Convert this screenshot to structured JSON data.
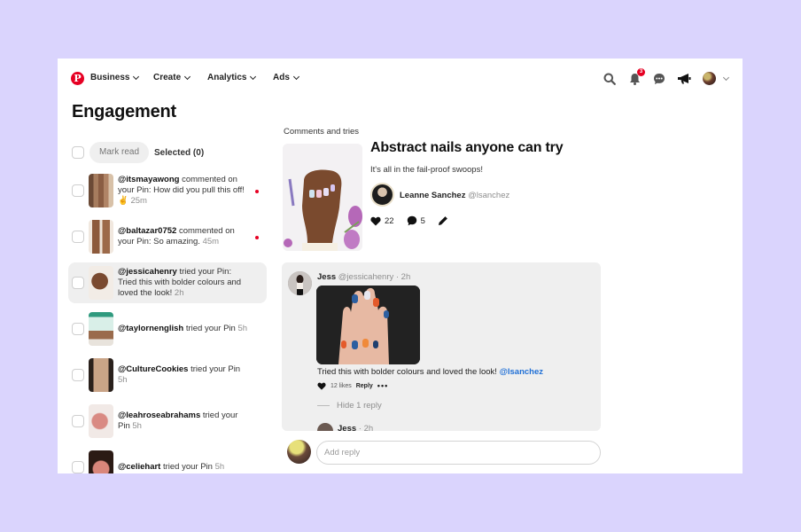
{
  "nav": {
    "logo": "P",
    "items": [
      {
        "label": "Business"
      },
      {
        "label": "Create"
      },
      {
        "label": "Analytics"
      },
      {
        "label": "Ads"
      }
    ],
    "notification_count": "3"
  },
  "page": {
    "title": "Engagement"
  },
  "toolbar": {
    "mark_read": "Mark read",
    "selected": "Selected (0)"
  },
  "notifications": [
    {
      "user": "@itsmayawong",
      "text": " commented on your Pin: How did you pull this off! ✌ ",
      "time": "25m",
      "unread": true
    },
    {
      "user": "@baltazar0752",
      "text": " commented on your Pin: So amazing. ",
      "time": "45m",
      "unread": true
    },
    {
      "user": "@jessicahenry",
      "text": " tried your Pin: Tried this with bolder colours and loved the look! ",
      "time": "2h",
      "unread": false,
      "active": true
    },
    {
      "user": "@taylornenglish",
      "text": " tried your Pin ",
      "time": "5h",
      "unread": false
    },
    {
      "user": "@CultureCookies",
      "text": " tried your Pin ",
      "time": "5h",
      "unread": false
    },
    {
      "user": "@leahroseabrahams",
      "text": " tried your Pin ",
      "time": "5h",
      "unread": false
    },
    {
      "user": "@celiehart",
      "text": " tried your Pin ",
      "time": "5h",
      "unread": false
    }
  ],
  "detail": {
    "section_label": "Comments and tries",
    "pin": {
      "title": "Abstract nails anyone can try",
      "description": "It's all in the fail-proof swoops!",
      "author_name": "Leanne Sanchez",
      "author_handle": "@lsanchez",
      "likes": "22",
      "comments": "5"
    },
    "comment": {
      "name": "Jess",
      "handle": "@jessicahenry · 2h",
      "text": "Tried this with bolder colours and loved the look! ",
      "mention": "@lsanchez",
      "likes": "12 likes",
      "reply_label": "Reply",
      "more": "•••",
      "hide_replies": "Hide 1 reply",
      "sub_reply_name": "Jess",
      "sub_reply_time": " · 2h"
    },
    "reply_placeholder": "Add reply"
  },
  "colors": {
    "brand": "#e60023",
    "background": "#dad4fd",
    "mention": "#1f6fd6"
  }
}
